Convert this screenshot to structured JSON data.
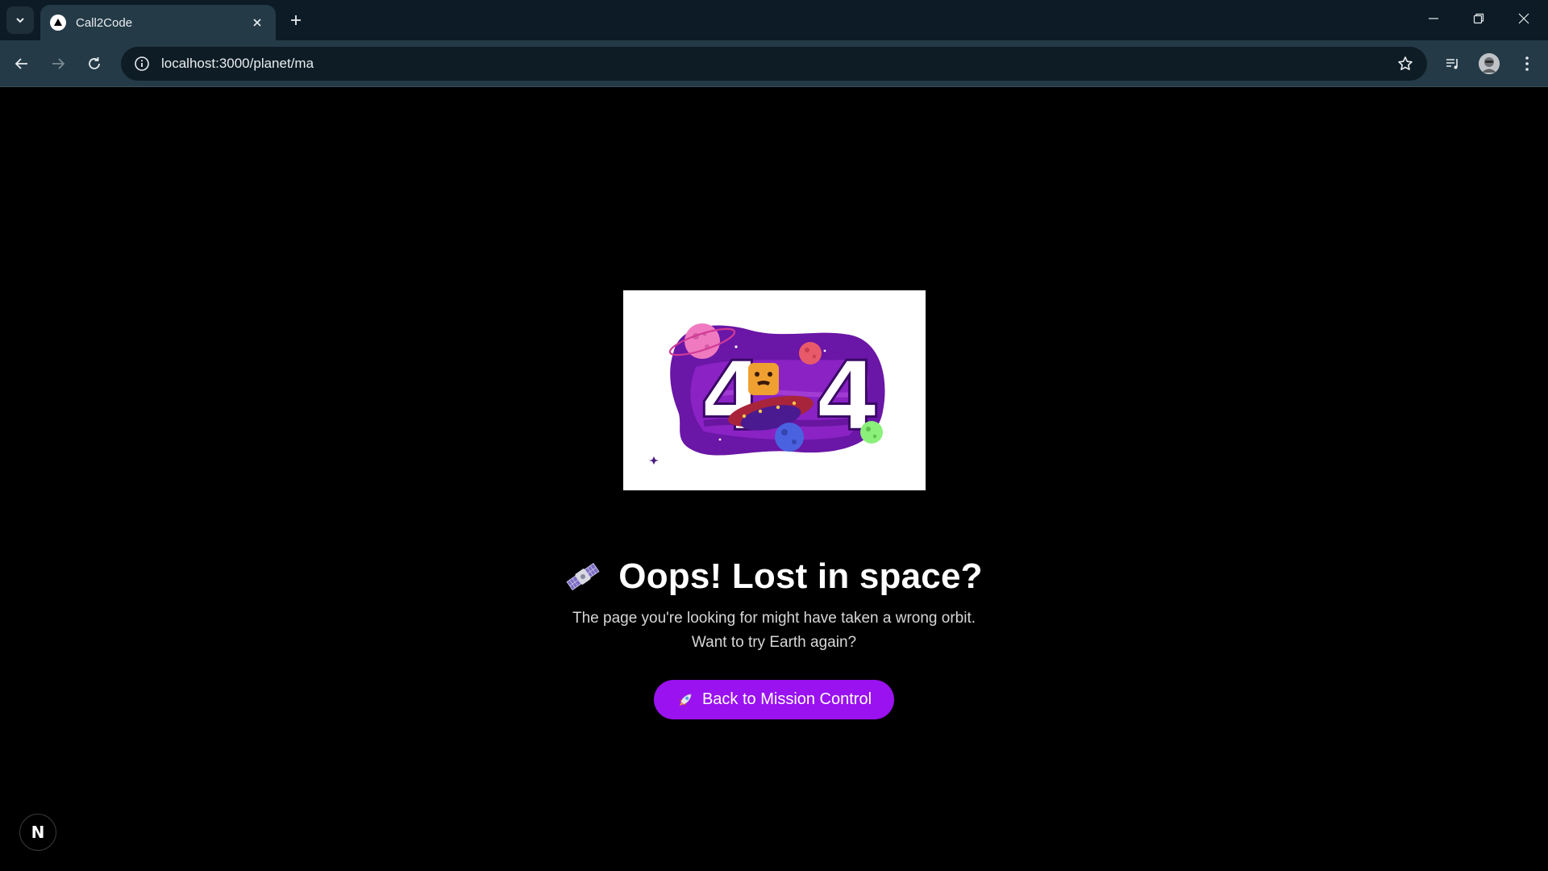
{
  "browser": {
    "tab_title": "Call2Code",
    "url": "localhost:3000/planet/ma",
    "icons": [
      "tab-search-icon",
      "triangle-favicon-icon",
      "close-icon",
      "plus-icon",
      "minimize-icon",
      "restore-icon",
      "close-window-icon",
      "back-arrow-icon",
      "forward-arrow-icon",
      "reload-icon",
      "info-icon",
      "star-icon",
      "media-control-icon",
      "avatar",
      "kebab-menu-icon"
    ]
  },
  "page": {
    "illustration_digits": [
      "4",
      "4"
    ],
    "title": "Oops! Lost in space?",
    "subtitle_line1": "The page you're looking for might have taken a wrong orbit.",
    "subtitle_line2": "Want to try Earth again?",
    "cta_label": "Back to Mission Control",
    "cta_icon": "rocket-icon",
    "dev_badge_letter": "N"
  },
  "colors": {
    "background": "#000000",
    "cta": "#9a12f0",
    "chrome_dark": "#0c1b25",
    "chrome_toolbar": "#243a47"
  }
}
